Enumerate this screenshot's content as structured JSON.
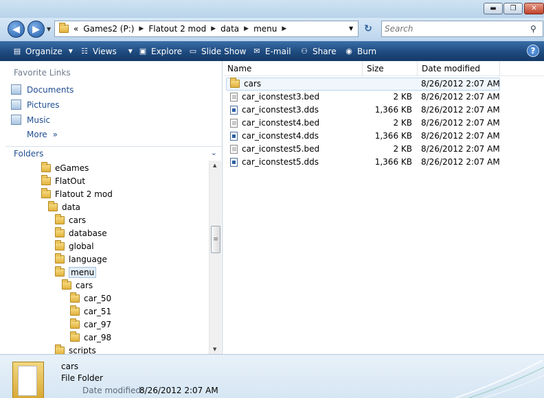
{
  "window": {
    "min_glyph": "▬",
    "max_glyph": "❐",
    "close_glyph": "✕"
  },
  "address": {
    "back_glyph": "◀",
    "forward_glyph": "▶",
    "overflow": "«",
    "crumbs": [
      "Games2 (P:)",
      "Flatout 2 mod",
      "data",
      "menu"
    ],
    "refresh_glyph": "↻",
    "search_placeholder": "Search"
  },
  "toolbar": {
    "organize": "Organize",
    "views": "Views",
    "explore": "Explore",
    "slideshow": "Slide Show",
    "email": "E-mail",
    "share": "Share",
    "burn": "Burn",
    "help": "?"
  },
  "favorites": {
    "title": "Favorite Links",
    "items": [
      "Documents",
      "Pictures",
      "Music"
    ],
    "more": "More",
    "more_chevron": "»"
  },
  "folders": {
    "title": "Folders",
    "chevron": "⌄",
    "tree": [
      {
        "label": "eGames",
        "level": 0
      },
      {
        "label": "FlatOut",
        "level": 0
      },
      {
        "label": "Flatout 2 mod",
        "level": 0
      },
      {
        "label": "data",
        "level": 1
      },
      {
        "label": "cars",
        "level": 2
      },
      {
        "label": "database",
        "level": 2
      },
      {
        "label": "global",
        "level": 2
      },
      {
        "label": "language",
        "level": 2
      },
      {
        "label": "menu",
        "level": 2,
        "selected": true
      },
      {
        "label": "cars",
        "level": 3
      },
      {
        "label": "car_50",
        "level": 4
      },
      {
        "label": "car_51",
        "level": 4
      },
      {
        "label": "car_97",
        "level": 4
      },
      {
        "label": "car_98",
        "level": 4
      },
      {
        "label": "scripts",
        "level": 2
      }
    ]
  },
  "columns": {
    "name": "Name",
    "size": "Size",
    "date": "Date modified"
  },
  "files": [
    {
      "name": "cars",
      "type": "folder",
      "size": "",
      "date": "8/26/2012 2:07 AM",
      "selected": true
    },
    {
      "name": "car_iconstest3.bed",
      "type": "bed",
      "size": "2 KB",
      "date": "8/26/2012 2:07 AM"
    },
    {
      "name": "car_iconstest3.dds",
      "type": "dds",
      "size": "1,366 KB",
      "date": "8/26/2012 2:07 AM"
    },
    {
      "name": "car_iconstest4.bed",
      "type": "bed",
      "size": "2 KB",
      "date": "8/26/2012 2:07 AM"
    },
    {
      "name": "car_iconstest4.dds",
      "type": "dds",
      "size": "1,366 KB",
      "date": "8/26/2012 2:07 AM"
    },
    {
      "name": "car_iconstest5.bed",
      "type": "bed",
      "size": "2 KB",
      "date": "8/26/2012 2:07 AM"
    },
    {
      "name": "car_iconstest5.dds",
      "type": "dds",
      "size": "1,366 KB",
      "date": "8/26/2012 2:07 AM"
    }
  ],
  "details": {
    "name": "cars",
    "type": "File Folder",
    "modified_label": "Date modified:",
    "modified_value": "8/26/2012 2:07 AM"
  },
  "colors": {
    "toolbar": "#1e4a7f",
    "link": "#1f4d90",
    "selection": "#e1ecf7"
  }
}
